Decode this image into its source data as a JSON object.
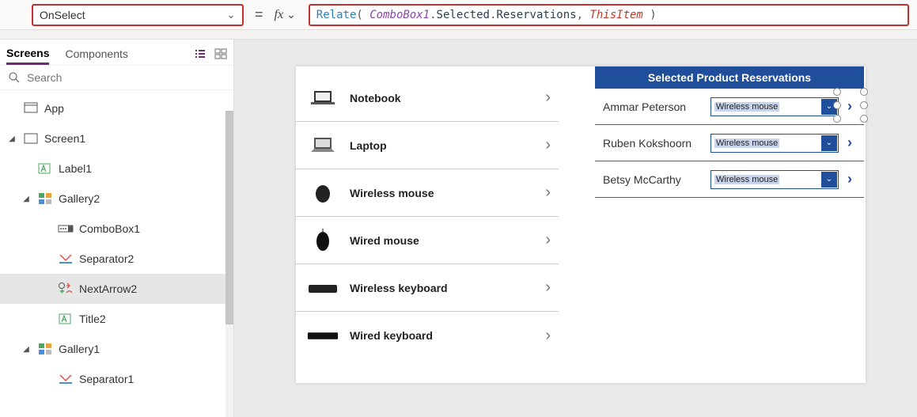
{
  "topbar": {
    "property": "OnSelect",
    "formula_tokens": {
      "fn": "Relate",
      "open": "( ",
      "obj": "ComboBox1",
      "dot1": ".",
      "p1": "Selected",
      "dot2": ".",
      "p2": "Reservations",
      "comma": ", ",
      "this": "ThisItem",
      "close": " )"
    }
  },
  "left": {
    "tabs": {
      "screens": "Screens",
      "components": "Components"
    },
    "search_placeholder": "Search",
    "tree": {
      "app": "App",
      "screen1": "Screen1",
      "label1": "Label1",
      "gallery2": "Gallery2",
      "combobox1": "ComboBox1",
      "separator2": "Separator2",
      "nextarrow2": "NextArrow2",
      "title2": "Title2",
      "gallery1": "Gallery1",
      "separator1": "Separator1"
    }
  },
  "stage": {
    "products": [
      {
        "name": "Notebook"
      },
      {
        "name": "Laptop"
      },
      {
        "name": "Wireless mouse"
      },
      {
        "name": "Wired mouse"
      },
      {
        "name": "Wireless keyboard"
      },
      {
        "name": "Wired keyboard"
      }
    ],
    "reservations_header": "Selected Product Reservations",
    "reservations": [
      {
        "person": "Ammar Peterson",
        "product": "Wireless mouse"
      },
      {
        "person": "Ruben Kokshoorn",
        "product": "Wireless mouse"
      },
      {
        "person": "Betsy McCarthy",
        "product": "Wireless mouse"
      }
    ]
  }
}
